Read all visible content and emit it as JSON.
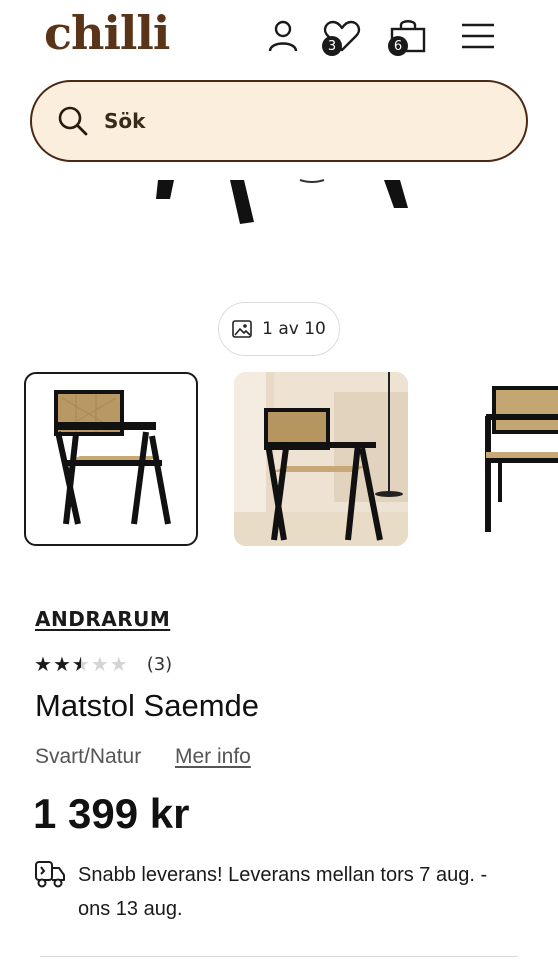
{
  "header": {
    "logo": "chilli",
    "wishlist_count": "3",
    "cart_count": "6"
  },
  "search": {
    "placeholder": "Sök"
  },
  "gallery": {
    "counter": "1 av 10"
  },
  "product": {
    "brand": "ANDRARUM",
    "rating": 2.5,
    "rating_max": 5,
    "rating_count": "(3)",
    "title": "Matstol Saemde",
    "variant": "Svart/Natur",
    "more_info": "Mer info",
    "price": "1 399 kr",
    "delivery": "Snabb leverans! Leverans mellan tors 7 aug. - ons 13 aug."
  },
  "colors": {
    "brand_brown": "#5a3418",
    "search_bg": "#fbeedd",
    "text": "#111111"
  },
  "icons": [
    "user-icon",
    "heart-icon",
    "bag-icon",
    "menu-icon",
    "search-icon",
    "image-icon",
    "delivery-truck-icon"
  ]
}
